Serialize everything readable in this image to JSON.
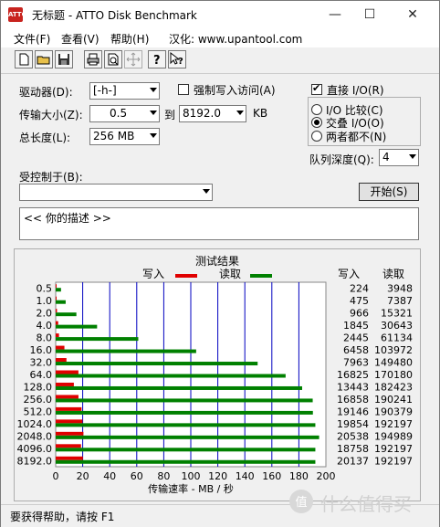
{
  "window": {
    "title": "无标题 - ATTO Disk Benchmark",
    "app_icon_text": "ATTO"
  },
  "titlebar": {
    "minimize": "—",
    "maximize": "☐",
    "close": "✕"
  },
  "menu": [
    "文件(F)",
    "查看(V)",
    "帮助(H)",
    "汉化: www.upantool.com"
  ],
  "toolbar": {
    "icons": [
      "new-icon",
      "open-icon",
      "save-icon",
      "print-icon",
      "print-preview-icon",
      "move-icon",
      "help-icon",
      "context-help-icon"
    ]
  },
  "settings": {
    "drive_label": "驱动器(D):",
    "drive_value": "[-h-]",
    "force_write_label": "强制写入访问(A)",
    "force_write_checked": false,
    "transfer_size_label": "传输大小(Z):",
    "transfer_from": "0.5",
    "to_label": "到",
    "transfer_to": "8192.0",
    "kb_label": "KB",
    "total_length_label": "总长度(L):",
    "total_length_value": "256 MB",
    "direct_io_label": "直接 I/O(R)",
    "direct_io_checked": true,
    "radio_io_compare": "I/O 比较(C)",
    "radio_overlap": "交叠 I/O(O)",
    "radio_neither": "两者都不(N)",
    "selected_radio": "overlap",
    "queue_depth_label": "队列深度(Q):",
    "queue_depth_value": "4",
    "controlled_by_label": "受控制于(B):",
    "controlled_by_value": "",
    "start_button": "开始(S)",
    "description": "<<  你的描述  >>"
  },
  "results": {
    "title": "测试结果",
    "write_legend": "写入",
    "read_legend": "读取",
    "write_col": "写入",
    "read_col": "读取",
    "write_color": "#e00000",
    "read_color": "#008000",
    "gridline_color": "#0000c0",
    "xlabel": "传输速率 - MB / 秒"
  },
  "chart_data": {
    "type": "bar",
    "orientation": "horizontal",
    "categories": [
      "0.5",
      "1.0",
      "2.0",
      "4.0",
      "8.0",
      "16.0",
      "32.0",
      "64.0",
      "128.0",
      "256.0",
      "512.0",
      "1024.0",
      "2048.0",
      "4096.0",
      "8192.0"
    ],
    "series": [
      {
        "name": "写入",
        "values": [
          224,
          475,
          966,
          1845,
          2445,
          6458,
          7963,
          16825,
          13443,
          16858,
          19146,
          19854,
          20538,
          18758,
          20137
        ]
      },
      {
        "name": "读取",
        "values": [
          3948,
          7387,
          15321,
          30643,
          61134,
          103972,
          149480,
          170180,
          182423,
          190241,
          190379,
          192197,
          194989,
          192197,
          192197
        ]
      }
    ],
    "x_ticks": [
      0,
      20,
      40,
      60,
      80,
      100,
      120,
      140,
      160,
      180,
      200
    ],
    "xlim": [
      0,
      200
    ],
    "value_scale": 1000,
    "xlabel": "传输速率 - MB / 秒",
    "grid": true,
    "legend": "top"
  },
  "status": {
    "text": "要获得帮助，请按 F1"
  },
  "watermark": {
    "text": "什么值得买",
    "symbol": "值"
  }
}
